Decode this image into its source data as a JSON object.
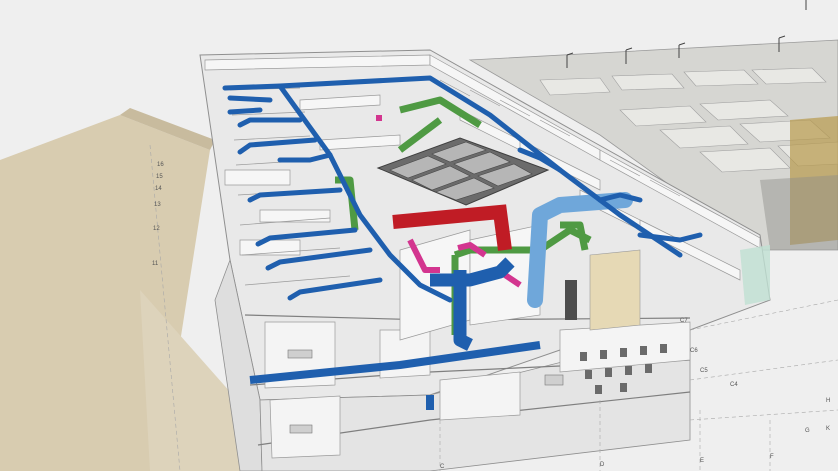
{
  "scene": {
    "colors": {
      "background": "#efefef",
      "ground": "#d8ccb0",
      "slab": "#e9e9e9",
      "wall": "#f6f6f6",
      "wall_edge": "#8f8f8f",
      "supply_duct": "#1f5fae",
      "supply_duct_light": "#6fa7da",
      "return_duct": "#4f9a43",
      "exhaust_duct": "#c01c25",
      "pink_duct": "#d3358f",
      "skylight": "#6b6b6b",
      "glass": "#bfe0d2",
      "neighbor_roof": "#cfd0cc",
      "bronze_glass": "#b89a4c"
    },
    "grid_labels": [
      "16",
      "15",
      "14",
      "13",
      "12",
      "11",
      "C",
      "D",
      "E",
      "F",
      "G",
      "H",
      "K",
      "C8",
      "C7",
      "C6",
      "C5",
      "C4"
    ]
  }
}
